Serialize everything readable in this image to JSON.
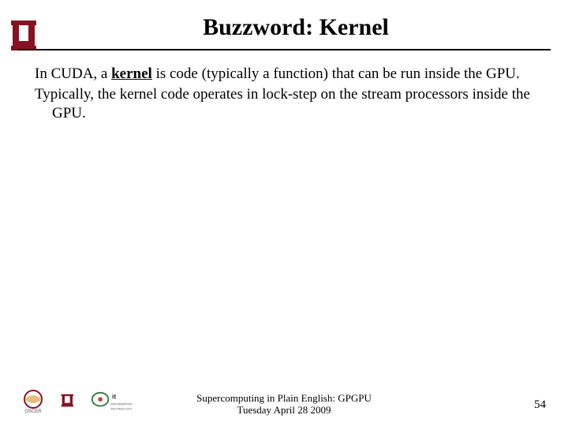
{
  "title": "Buzzword: Kernel",
  "body": {
    "p1_a": "In CUDA, a ",
    "keyword": "kernel",
    "p1_b": " is code (typically a function) that can be run inside the GPU.",
    "p2": "Typically, the kernel code operates in lock-step on the stream processors inside the GPU."
  },
  "footer": {
    "line1": "Supercomputing in Plain English: GPGPU",
    "line2": "Tuesday April 28 2009"
  },
  "page_number": "54"
}
